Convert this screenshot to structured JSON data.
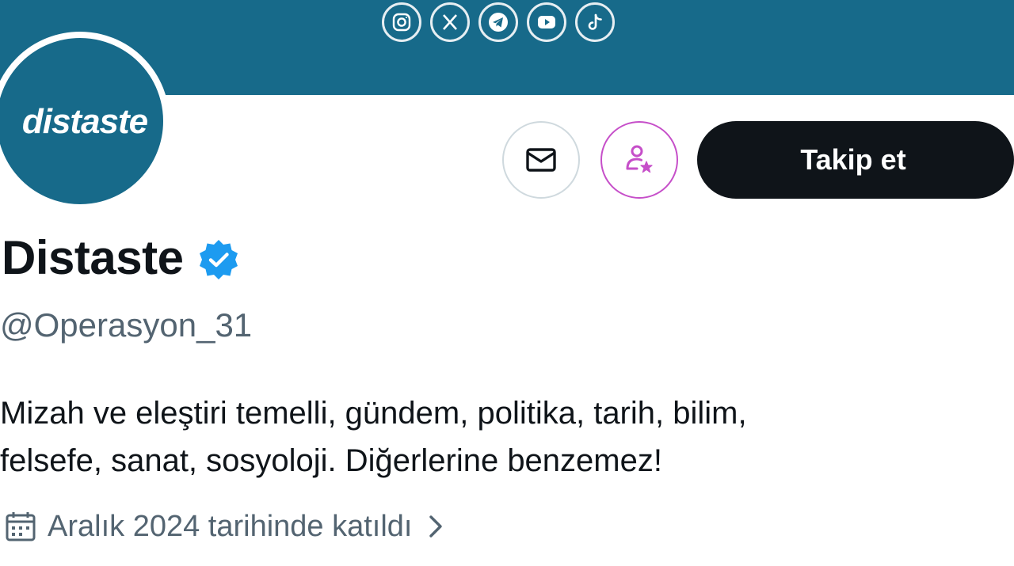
{
  "banner": {
    "color": "#176a8a",
    "social_icons": [
      "instagram-icon",
      "x-icon",
      "telegram-icon",
      "youtube-icon",
      "tiktok-icon"
    ]
  },
  "avatar": {
    "text": "distaste",
    "color": "#176a8a"
  },
  "actions": {
    "message_icon": "envelope-icon",
    "subscribe_icon": "person-star-icon",
    "follow_label": "Takip et"
  },
  "profile": {
    "display_name": "Distaste",
    "verified": true,
    "handle": "@Operasyon_31",
    "bio_line1": "Mizah ve eleştiri temelli, gündem, politika, tarih, bilim,",
    "bio_line2": "felsefe, sanat, sosyoloji. Diğerlerine benzemez!",
    "joined_text": "Aralık 2024 tarihinde katıldı"
  },
  "colors": {
    "accent_verified": "#1d9bf0",
    "subscribe": "#c64fc9",
    "follow_button": "#0f1419",
    "secondary_text": "#536471"
  }
}
